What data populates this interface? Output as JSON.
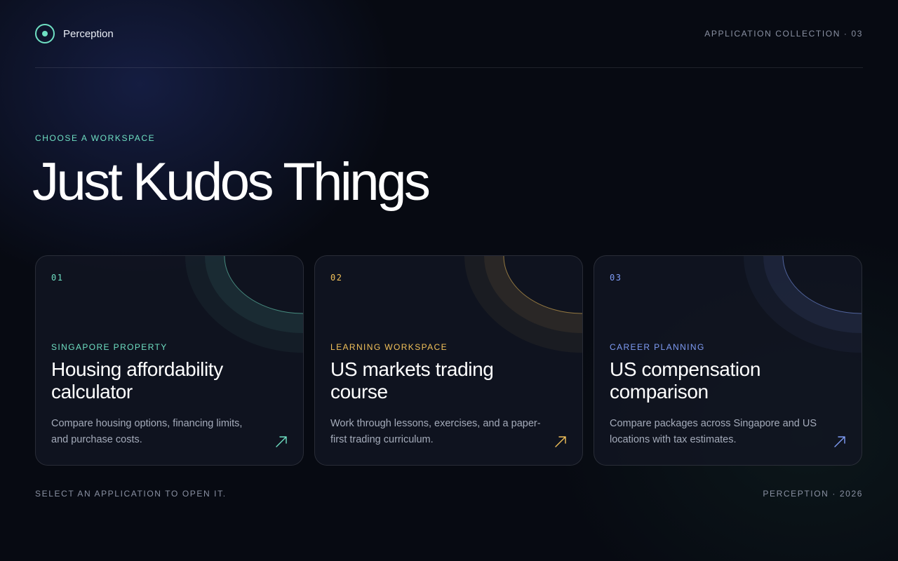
{
  "header": {
    "brand_name": "Perception",
    "collection_label": "APPLICATION COLLECTION · 03"
  },
  "hero": {
    "eyebrow": "CHOOSE A WORKSPACE",
    "title": "Just Kudos Things"
  },
  "cards": [
    {
      "number": "01",
      "category": "SINGAPORE PROPERTY",
      "title": "Housing affordability calculator",
      "description": "Compare housing options, financing limits, and purchase costs.",
      "accent": "#6fe0c3",
      "icon": "arrow-up-right-icon"
    },
    {
      "number": "02",
      "category": "LEARNING WORKSPACE",
      "title": "US markets trading course",
      "description": "Work through lessons, exercises, and a paper-first trading curriculum.",
      "accent": "#f2c15a",
      "icon": "arrow-up-right-icon"
    },
    {
      "number": "03",
      "category": "CAREER PLANNING",
      "title": "US compensation comparison",
      "description": "Compare packages across Singapore and US locations with tax estimates.",
      "accent": "#7f9cf5",
      "icon": "arrow-up-right-icon"
    }
  ],
  "footer": {
    "left": "SELECT AN APPLICATION TO OPEN IT.",
    "right": "PERCEPTION · 2026"
  },
  "colors": {
    "background": "#070a12",
    "brand_accent": "#6fe0c3",
    "muted_text": "#8a91a3"
  }
}
